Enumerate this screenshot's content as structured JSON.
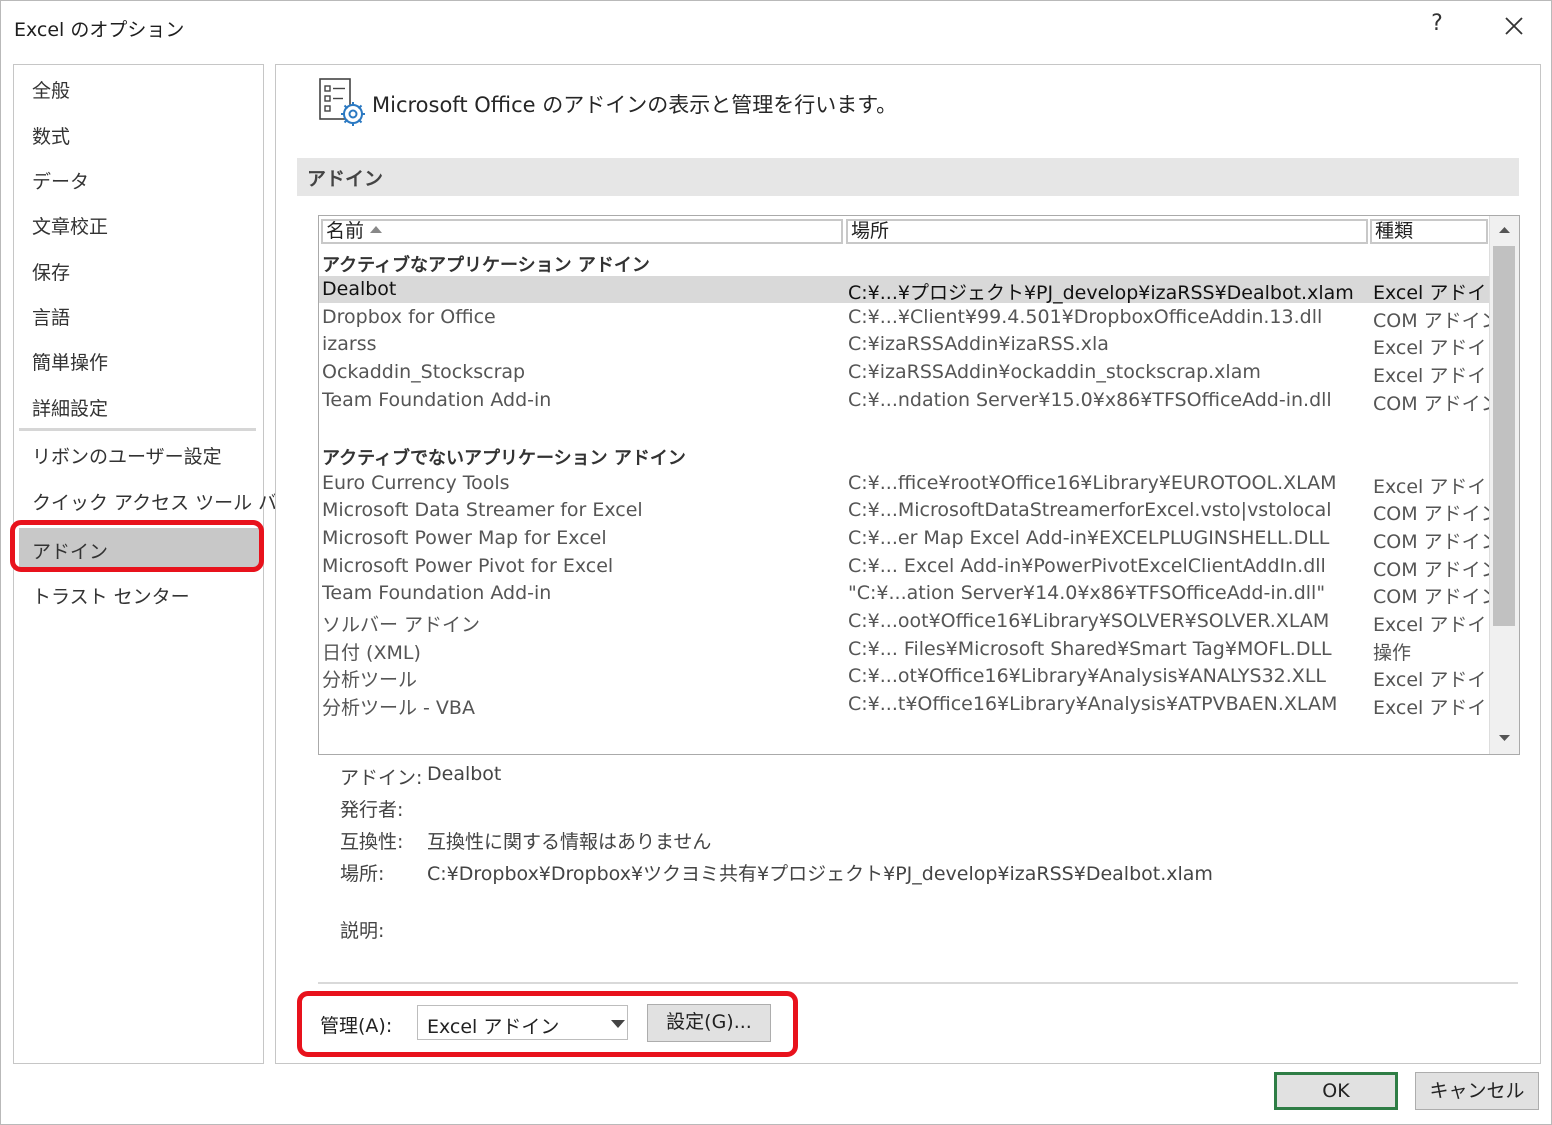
{
  "window": {
    "title": "Excel のオプション",
    "help": "?"
  },
  "sidebar": {
    "items": [
      {
        "label": "全般"
      },
      {
        "label": "数式"
      },
      {
        "label": "データ"
      },
      {
        "label": "文章校正"
      },
      {
        "label": "保存"
      },
      {
        "label": "言語"
      },
      {
        "label": "簡単操作"
      },
      {
        "label": "詳細設定"
      },
      {
        "label": "リボンのユーザー設定"
      },
      {
        "label": "クイック アクセス ツール バー"
      },
      {
        "label": "アドイン",
        "selected": true
      },
      {
        "label": "トラスト センター"
      }
    ]
  },
  "main": {
    "header_text": "Microsoft Office のアドインの表示と管理を行います。",
    "section_title": "アドイン",
    "columns": [
      "名前",
      "場所",
      "種類"
    ],
    "groups": [
      {
        "title": "アクティブなアプリケーション アドイン",
        "rows": [
          {
            "name": "Dealbot",
            "location": "C:¥...¥プロジェクト¥PJ_develop¥izaRSS¥Dealbot.xlam",
            "type": "Excel アドイン",
            "selected": true
          },
          {
            "name": "Dropbox for Office",
            "location": "C:¥...¥Client¥99.4.501¥DropboxOfficeAddin.13.dll",
            "type": "COM アドイン"
          },
          {
            "name": "izarss",
            "location": "C:¥izaRSSAddin¥izaRSS.xla",
            "type": "Excel アドイン"
          },
          {
            "name": "Ockaddin_Stockscrap",
            "location": "C:¥izaRSSAddin¥ockaddin_stockscrap.xlam",
            "type": "Excel アドイン"
          },
          {
            "name": "Team Foundation Add-in",
            "location": "C:¥...ndation Server¥15.0¥x86¥TFSOfficeAdd-in.dll",
            "type": "COM アドイン"
          }
        ]
      },
      {
        "title": "アクティブでないアプリケーション アドイン",
        "rows": [
          {
            "name": "Euro Currency Tools",
            "location": "C:¥...ffice¥root¥Office16¥Library¥EUROTOOL.XLAM",
            "type": "Excel アドイン"
          },
          {
            "name": "Microsoft Data Streamer for Excel",
            "location": "C:¥...MicrosoftDataStreamerforExcel.vsto|vstolocal",
            "type": "COM アドイン"
          },
          {
            "name": "Microsoft Power Map for Excel",
            "location": "C:¥...er Map Excel Add-in¥EXCELPLUGINSHELL.DLL",
            "type": "COM アドイン"
          },
          {
            "name": "Microsoft Power Pivot for Excel",
            "location": "C:¥... Excel Add-in¥PowerPivotExcelClientAddIn.dll",
            "type": "COM アドイン"
          },
          {
            "name": "Team Foundation Add-in",
            "location": "\"C:¥...ation Server¥14.0¥x86¥TFSOfficeAdd-in.dll\"",
            "type": "COM アドイン"
          },
          {
            "name": "ソルバー アドイン",
            "location": "C:¥...oot¥Office16¥Library¥SOLVER¥SOLVER.XLAM",
            "type": "Excel アドイン"
          },
          {
            "name": "日付 (XML)",
            "location": "C:¥... Files¥Microsoft Shared¥Smart Tag¥MOFL.DLL",
            "type": "操作"
          },
          {
            "name": "分析ツール",
            "location": "C:¥...ot¥Office16¥Library¥Analysis¥ANALYS32.XLL",
            "type": "Excel アドイン"
          },
          {
            "name": "分析ツール - VBA",
            "location": "C:¥...t¥Office16¥Library¥Analysis¥ATPVBAEN.XLAM",
            "type": "Excel アドイン"
          }
        ]
      }
    ],
    "details": {
      "addin_label": "アドイン:",
      "addin_value": "Dealbot",
      "publisher_label": "発行者:",
      "publisher_value": "",
      "compat_label": "互換性:",
      "compat_value": "互換性に関する情報はありません",
      "location_label": "場所:",
      "location_value": "C:¥Dropbox¥Dropbox¥ツクヨミ共有¥プロジェクト¥PJ_develop¥izaRSS¥Dealbot.xlam",
      "desc_label": "説明:",
      "desc_value": ""
    },
    "manage": {
      "label": "管理(A):",
      "label_mnemonic": "A",
      "selected": "Excel アドイン",
      "go_label": "設定(G)...",
      "go_mnemonic": "G"
    }
  },
  "footer": {
    "ok": "OK",
    "cancel": "キャンセル"
  },
  "colors": {
    "highlight": "#e8121c",
    "ok_border": "#2e7d45",
    "selection": "#d9d9d9"
  },
  "icons": [
    "close-icon",
    "addin-settings-icon",
    "sort-ascending-icon",
    "scroll-up-icon",
    "scroll-down-icon",
    "dropdown-arrow-icon"
  ]
}
